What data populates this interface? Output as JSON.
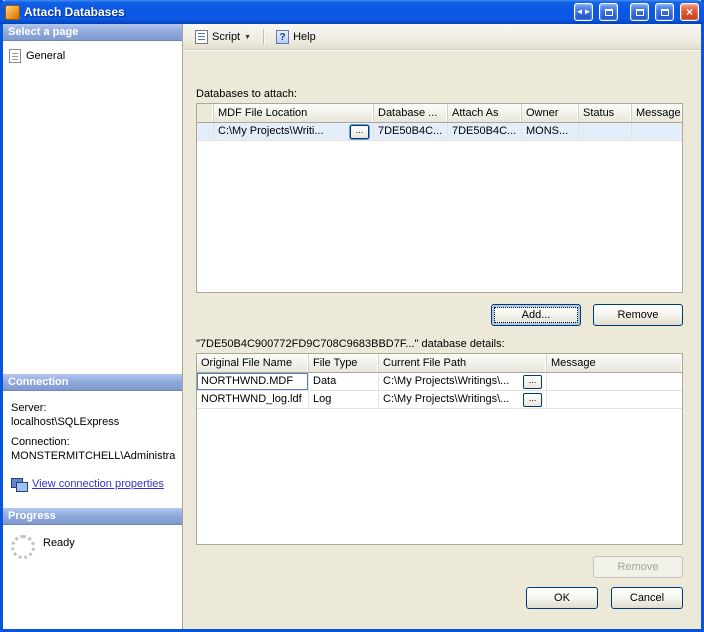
{
  "window": {
    "title": "Attach Databases",
    "controls": {
      "nav": "◄►",
      "close": "×"
    }
  },
  "colors": {
    "titlebar_blue": "#0855DD",
    "panel_header_blue": "#7E9BD1",
    "link_blue": "#3333CC",
    "close_red": "#C13E1F",
    "dialog_background": "#ECE9D8"
  },
  "toolbar": {
    "script": "Script",
    "help": "Help"
  },
  "sidebar": {
    "select_page": {
      "header": "Select a page",
      "items": [
        {
          "label": "General"
        }
      ]
    },
    "connection": {
      "header": "Connection",
      "server_label": "Server:",
      "server_value": "localhost\\SQLExpress",
      "connection_label": "Connection:",
      "connection_value": "MONSTERMITCHELL\\Administra",
      "link": "View connection properties"
    },
    "progress": {
      "header": "Progress",
      "status": "Ready"
    }
  },
  "main": {
    "attach": {
      "label": "Databases to attach:",
      "headers": [
        "MDF File Location",
        "Database ...",
        "Attach As",
        "Owner",
        "Status",
        "Message"
      ],
      "rows": [
        {
          "mdf": "C:\\My Projects\\Writi...",
          "browse": "...",
          "database": "7DE50B4C...",
          "attach_as": "7DE50B4C...",
          "owner": "MONS...",
          "status": "",
          "message": ""
        }
      ],
      "add": "Add...",
      "remove": "Remove"
    },
    "details": {
      "label": "\"7DE50B4C900772FD9C708C9683BBD7F...\" database details:",
      "headers": [
        "Original File Name",
        "File Type",
        "Current File Path",
        "Message"
      ],
      "rows": [
        {
          "name": "NORTHWND.MDF",
          "type": "Data",
          "path": "C:\\My Projects\\Writings\\...",
          "browse": "...",
          "message": ""
        },
        {
          "name": "NORTHWND_log.ldf",
          "type": "Log",
          "path": "C:\\My Projects\\Writings\\...",
          "browse": "...",
          "message": ""
        }
      ],
      "remove": "Remove"
    },
    "footer": {
      "ok": "OK",
      "cancel": "Cancel"
    }
  }
}
